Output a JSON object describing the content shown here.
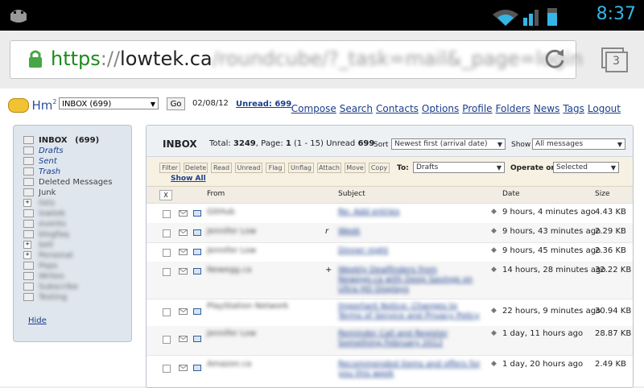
{
  "status_bar": {
    "time": "8:37"
  },
  "browser": {
    "url_scheme": "https",
    "url_sep": "://",
    "url_host": "lowtek.ca",
    "url_path": "/roundcube/?_task=mail&_page=login",
    "tab_count": "3"
  },
  "header": {
    "logo_text": "Hm",
    "logo_sup": "2",
    "folder_select": "INBOX (699)",
    "go_label": "Go",
    "date": "02/08/12",
    "unread": "Unread: 699",
    "nav": [
      "Compose",
      "Search",
      "Contacts",
      "Options",
      "Profile",
      "Folders",
      "News",
      "Tags",
      "Logout"
    ]
  },
  "sidebar": {
    "folders": [
      {
        "name": "INBOX",
        "count": "(699)"
      },
      {
        "name": "Drafts"
      },
      {
        "name": "Sent"
      },
      {
        "name": "Trash"
      },
      {
        "name": "Deleted Messages"
      },
      {
        "name": "Junk"
      },
      {
        "name": "lists"
      },
      {
        "name": "lowtek"
      },
      {
        "name": "events"
      },
      {
        "name": "blogfaq"
      },
      {
        "name": "bell"
      },
      {
        "name": "Personal"
      },
      {
        "name": "Pops"
      },
      {
        "name": "Writes"
      },
      {
        "name": "Subscribe"
      },
      {
        "name": "Testing"
      }
    ],
    "hide_label": "Hide"
  },
  "mailbox": {
    "title": "INBOX",
    "total_label": "Total: ",
    "total": "3249",
    "page_label": ", Page: ",
    "page": "1",
    "range": " (1 - 15)",
    "unread_label": "  Unread ",
    "unread": "699",
    "sort_label": "Sort",
    "sort_value": "Newest first (arrival date)",
    "show_label": "Show",
    "show_value": "All messages",
    "toolbar": [
      "Filter",
      "Delete",
      "Read",
      "Unread",
      "Flag",
      "Unflag",
      "Attach",
      "Move",
      "Copy"
    ],
    "to_label": "To:",
    "to_value": "Drafts",
    "operate_label": "Operate on:",
    "operate_value": "Selected",
    "show_all": "Show All",
    "columns": {
      "x": "X",
      "from": "From",
      "subject": "Subject",
      "date": "Date",
      "size": "Size"
    },
    "messages": [
      {
        "from": "GitHub",
        "flag": "",
        "subject": "Re: Add entries",
        "date": "9 hours, 4 minutes ago",
        "size": "4.43 KB"
      },
      {
        "from": "Jennifer Low",
        "flag": "r",
        "subject": "Week",
        "date": "9 hours, 43 minutes ago",
        "size": "2.29 KB"
      },
      {
        "from": "Jennifer Low",
        "flag": "",
        "subject": "Dinner night",
        "date": "9 hours, 45 minutes ago",
        "size": "2.36 KB"
      },
      {
        "from": "Newegg.ca",
        "flag": "+",
        "subject": "Weekly Dealfinders from Newegg.ca with Deep Savings on Ultra HD Displays",
        "date": "14 hours, 28 minutes ago",
        "size": "32.22 KB"
      },
      {
        "from": "PlayStation Network",
        "flag": "",
        "subject": "Important Notice: Changes to Terms of Service and Privacy Policy",
        "date": "22 hours, 9 minutes ago",
        "size": "30.94 KB"
      },
      {
        "from": "Jennifer Low",
        "flag": "",
        "subject": "Reminder Call and Register Something February 2012",
        "date": "1 day, 11 hours ago",
        "size": "28.87 KB"
      },
      {
        "from": "Amazon.ca",
        "flag": "",
        "subject": "Recommended items and offers for you this week",
        "date": "1 day, 20 hours ago",
        "size": "2.49 KB"
      }
    ]
  }
}
